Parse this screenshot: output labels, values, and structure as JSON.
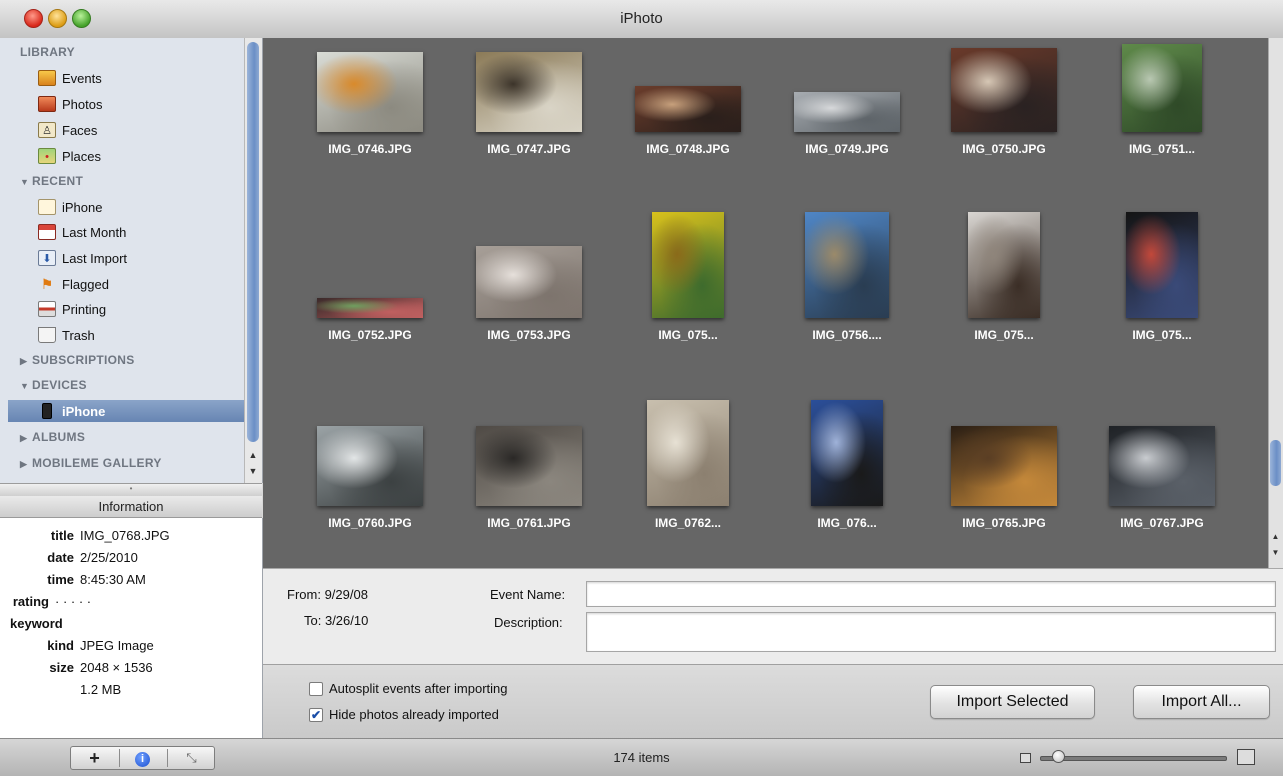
{
  "window": {
    "title": "iPhoto"
  },
  "sidebar": {
    "library_header": "LIBRARY",
    "library_items": [
      {
        "label": "Events",
        "icon": "events-icon"
      },
      {
        "label": "Photos",
        "icon": "photos-icon"
      },
      {
        "label": "Faces",
        "icon": "faces-icon"
      },
      {
        "label": "Places",
        "icon": "places-icon"
      }
    ],
    "recent_header": "RECENT",
    "recent_items": [
      {
        "label": "iPhone",
        "icon": "iphone-album-icon"
      },
      {
        "label": "Last Month",
        "icon": "calendar-icon"
      },
      {
        "label": "Last Import",
        "icon": "import-icon"
      },
      {
        "label": "Flagged",
        "icon": "flag-icon"
      },
      {
        "label": "Printing",
        "icon": "printer-icon"
      },
      {
        "label": "Trash",
        "icon": "trash-icon"
      }
    ],
    "subscriptions_header": "SUBSCRIPTIONS",
    "devices_header": "DEVICES",
    "device_items": [
      {
        "label": "iPhone",
        "icon": "iphone-device-icon",
        "selected": true
      }
    ],
    "albums_header": "ALBUMS",
    "mobileme_header": "MOBILEME GALLERY"
  },
  "info": {
    "header": "Information",
    "title_key": "title",
    "title": "IMG_0768.JPG",
    "date_key": "date",
    "date": "2/25/2010",
    "time_key": "time",
    "time": "8:45:30 AM",
    "rating_key": "rating",
    "rating": "· · · · ·",
    "keyword_key": "keyword",
    "kind_key": "kind",
    "kind": "JPEG Image",
    "size_key": "size",
    "size": "2048 × 1536",
    "filesize": "1.2 MB"
  },
  "photos": [
    {
      "caption": "IMG_0746.JPG",
      "colors": [
        "#d9dcd6",
        "#8c8a80",
        "#d98a2b"
      ]
    },
    {
      "caption": "IMG_0747.JPG",
      "colors": [
        "#8b7a57",
        "#d9d4c6",
        "#3c342a"
      ]
    },
    {
      "caption": "IMG_0748.JPG",
      "colors": [
        "#6b3d2c",
        "#2a1f1b",
        "#c7a07c"
      ]
    },
    {
      "caption": "IMG_0749.JPG",
      "colors": [
        "#a7acb1",
        "#5e6469",
        "#d7d9db"
      ]
    },
    {
      "caption": "IMG_0750.JPG",
      "colors": [
        "#6a3a2a",
        "#2a2222",
        "#d6c7b5"
      ]
    },
    {
      "caption": "IMG_0751...",
      "colors": [
        "#5f8a4a",
        "#2f4a28",
        "#b9c8b2"
      ]
    },
    {
      "caption": "IMG_0752.JPG",
      "colors": [
        "#3a2a2a",
        "#c06060",
        "#6f9f5f"
      ]
    },
    {
      "caption": "IMG_0753.JPG",
      "colors": [
        "#a79f98",
        "#7d746d",
        "#e6e0db"
      ]
    },
    {
      "caption": "IMG_075...",
      "colors": [
        "#d8c11c",
        "#3e6b2d",
        "#8a6a1a"
      ]
    },
    {
      "caption": "IMG_0756....",
      "colors": [
        "#4f86c6",
        "#2a3d52",
        "#9b8a6a"
      ]
    },
    {
      "caption": "IMG_075...",
      "colors": [
        "#d9d6d2",
        "#3b2e26",
        "#8f857b"
      ]
    },
    {
      "caption": "IMG_075...",
      "colors": [
        "#141414",
        "#3a4a78",
        "#c2483a"
      ]
    },
    {
      "caption": "IMG_0760.JPG",
      "colors": [
        "#9ba3a6",
        "#3c4142",
        "#e3e6e7"
      ]
    },
    {
      "caption": "IMG_0761.JPG",
      "colors": [
        "#4f4a45",
        "#8b867e",
        "#2a2826"
      ]
    },
    {
      "caption": "IMG_0762...",
      "colors": [
        "#c8bfae",
        "#8c8070",
        "#e7e1d4"
      ]
    },
    {
      "caption": "IMG_076...",
      "colors": [
        "#2b4f9a",
        "#1a1a1a",
        "#9fb2d9"
      ]
    },
    {
      "caption": "IMG_0765.JPG",
      "colors": [
        "#2a1e14",
        "#c4883a",
        "#5a3e24"
      ]
    },
    {
      "caption": "IMG_0767.JPG",
      "colors": [
        "#1f2226",
        "#5a6068",
        "#c9ccd0"
      ]
    }
  ],
  "event": {
    "from_label": "From:",
    "from_value": "9/29/08",
    "to_label": "To:",
    "to_value": "3/26/10",
    "name_label": "Event Name:",
    "name_value": "",
    "description_label": "Description:",
    "description_value": ""
  },
  "import": {
    "autosplit_label": "Autosplit events after importing",
    "autosplit_checked": false,
    "hide_label": "Hide photos already imported",
    "hide_checked": true,
    "import_selected_label": "Import Selected",
    "import_all_label": "Import All..."
  },
  "toolbar": {
    "add_label": "+",
    "info_label": "i",
    "fullscreen_label": "⤡",
    "status_text": "174 items",
    "zoom_level": 0.07
  }
}
